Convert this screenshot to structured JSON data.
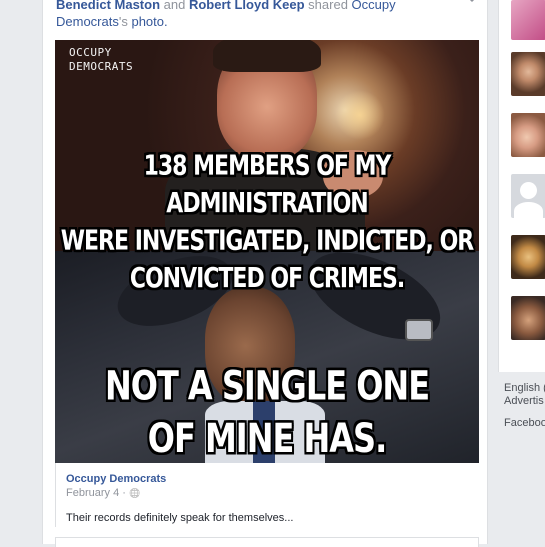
{
  "story": {
    "actor_1": "Benedict Maston",
    "conjunction": "and",
    "actor_2": "Robert Lloyd Keep",
    "action": "shared",
    "page_name_line1": "Occupy",
    "page_name_line2": "Democrats",
    "possessive_suffix": "'s",
    "object": "photo."
  },
  "photo": {
    "watermark_line1": "OCCUPY",
    "watermark_line2": "DEMOCRATS",
    "top_text_line1": "138 MEMBERS OF MY ADMINISTRATION",
    "top_text_line2": "WERE INVESTIGATED, INDICTED, OR",
    "top_text_line3": "CONVICTED OF CRIMES.",
    "bottom_text_line1": "NOT A SINGLE ONE",
    "bottom_text_line2": "OF MINE HAS."
  },
  "source": {
    "name": "Occupy Democrats",
    "date": "February 4 · ",
    "privacy_icon_glyph": "🌐",
    "caption": "Their records definitely speak for themselves..."
  },
  "sidebar_footer": {
    "link_1": "English (",
    "link_2": "Advertis",
    "link_3": "Faceboo"
  },
  "colors": {
    "link": "#365899",
    "meta": "#90949c",
    "background": "#e9ebee"
  },
  "icons": [
    "chevron-down-icon",
    "globe-icon"
  ]
}
